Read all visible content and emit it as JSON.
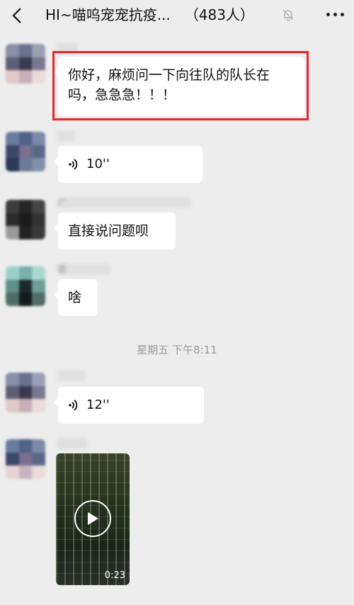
{
  "header": {
    "group_name": "HI~喵呜宠宠抗疫...",
    "member_count": "（483人）",
    "back_icon": "chevron-left-icon",
    "mute_icon": "bell-muted-icon",
    "more_icon": "more-dots-icon"
  },
  "messages": [
    {
      "type": "text",
      "text": "你好，麻烦问一下向往队的队长在吗，急急急！！！"
    },
    {
      "type": "voice",
      "duration": "10''"
    },
    {
      "type": "text",
      "sender_partial": "广",
      "text": "直接说问题呗"
    },
    {
      "type": "text",
      "sender_partial": "荔",
      "text": "啥"
    },
    {
      "type": "time",
      "text": "星期五 下午8:11"
    },
    {
      "type": "voice",
      "duration": "12''"
    },
    {
      "type": "video",
      "duration": "0:23"
    }
  ],
  "colors": {
    "background": "#ededed",
    "bubble": "#ffffff",
    "highlight_border": "#e8262b",
    "timestamp": "#9a9a9a"
  }
}
